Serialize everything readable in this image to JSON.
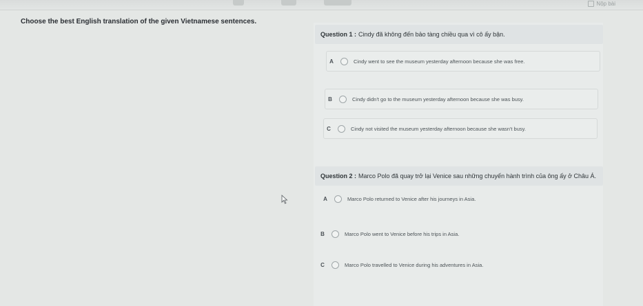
{
  "header": {
    "top_right_label": "Nộp bài"
  },
  "instruction": "Choose the best English translation of the given Vietnamese sentences.",
  "questions": [
    {
      "label": "Question 1 :",
      "text": "Cindy đã không đến bảo tàng chiều qua vì cô ấy bận.",
      "options": [
        {
          "letter": "A",
          "text": "Cindy went to see the museum yesterday afternoon because she was free."
        },
        {
          "letter": "B",
          "text": "Cindy didn't go to the museum yesterday afternoon because she was busy."
        },
        {
          "letter": "C",
          "text": "Cindy not visited the museum yesterday afternoon because she wasn't busy."
        }
      ]
    },
    {
      "label": "Question 2 :",
      "text": "Marco Polo đã quay trở lại Venice sau những chuyến hành trình của ông ấy ở Châu Á.",
      "options": [
        {
          "letter": "A",
          "text": "Marco Polo returned to Venice after his journeys in Asia."
        },
        {
          "letter": "B",
          "text": "Marco Polo went to Venice before his trips in Asia."
        },
        {
          "letter": "C",
          "text": "Marco Polo travelled to Venice during his adventures in Asia."
        }
      ]
    }
  ]
}
